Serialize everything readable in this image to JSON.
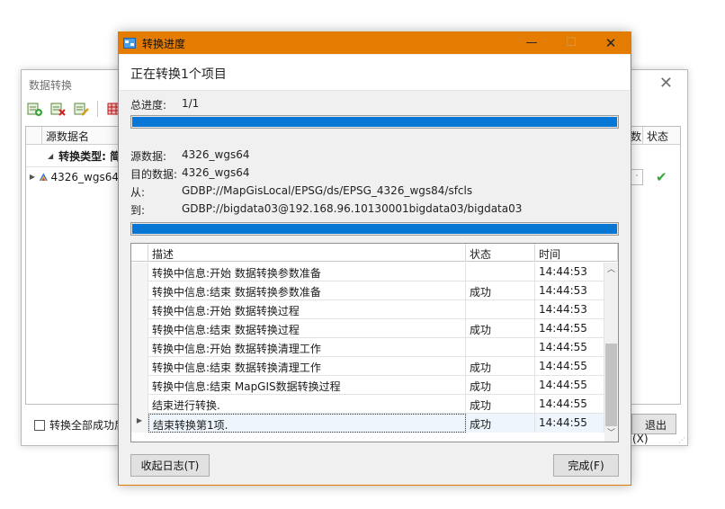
{
  "background_window": {
    "title": "数据转换",
    "source_col": "源数据名",
    "group_label": "转换类型: 简",
    "row_name": "4326_wgs64",
    "right_col_partial": "数",
    "status_col": "状态",
    "checkbox_label": "转换全部成功后",
    "exit_label": "退出(X)"
  },
  "dialog": {
    "title": "转换进度",
    "heading": "正在转换1个项目",
    "total_progress_label": "总进度:",
    "total_progress_value": "1/1",
    "total_progress_fraction": 1.0,
    "source_label": "源数据:",
    "source_value": "4326_wgs64",
    "target_label": "目的数据:",
    "target_value": "4326_wgs64",
    "from_label": "从:",
    "from_value": "GDBP://MapGisLocal/EPSG/ds/EPSG_4326_wgs84/sfcls",
    "to_label": "到:",
    "to_value": "GDBP://bigdata03@192.168.96.10130001bigdata03/bigdata03",
    "item_progress_fraction": 1.0,
    "log": {
      "headers": [
        "描述",
        "状态",
        "时间"
      ],
      "rows": [
        {
          "desc": "转换中信息:开始 数据转换参数准备",
          "status": "",
          "time": "14:44:53"
        },
        {
          "desc": "转换中信息:结束 数据转换参数准备",
          "status": "成功",
          "time": "14:44:53"
        },
        {
          "desc": "转换中信息:开始 数据转换过程",
          "status": "",
          "time": "14:44:53"
        },
        {
          "desc": "转换中信息:结束 数据转换过程",
          "status": "成功",
          "time": "14:44:55"
        },
        {
          "desc": "转换中信息:开始 数据转换清理工作",
          "status": "",
          "time": "14:44:55"
        },
        {
          "desc": "转换中信息:结束 数据转换清理工作",
          "status": "成功",
          "time": "14:44:55"
        },
        {
          "desc": "转换中信息:结束 MapGIS数据转换过程",
          "status": "成功",
          "time": "14:44:55"
        },
        {
          "desc": "结束进行转换.",
          "status": "成功",
          "time": "14:44:55"
        },
        {
          "desc": "结束转换第1项.",
          "status": "成功",
          "time": "14:44:55"
        }
      ]
    },
    "collapse_log_label": "收起日志(T)",
    "finish_label": "完成(F)"
  },
  "colors": {
    "title_bar": "#e37c00",
    "progress_fill": "#0677d4",
    "success_check": "#3aa53a"
  }
}
